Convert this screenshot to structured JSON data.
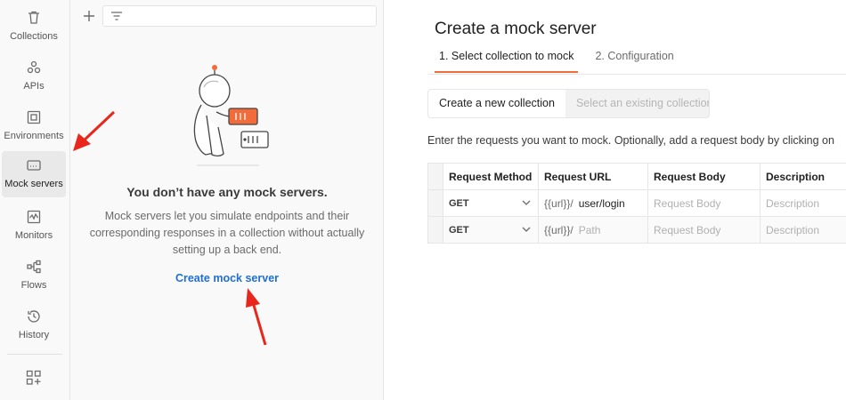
{
  "rail": {
    "items": [
      {
        "label": "Collections",
        "icon": "trash-can-icon"
      },
      {
        "label": "APIs",
        "icon": "apis-icon"
      },
      {
        "label": "Environments",
        "icon": "environments-icon"
      },
      {
        "label": "Mock servers",
        "icon": "server-icon",
        "active": true
      },
      {
        "label": "Monitors",
        "icon": "monitor-icon"
      },
      {
        "label": "Flows",
        "icon": "flows-icon"
      },
      {
        "label": "History",
        "icon": "history-icon"
      }
    ],
    "bottom_icon": "grid-plus-icon"
  },
  "panel": {
    "empty_title": "You don’t have any mock servers.",
    "empty_description": "Mock servers let you simulate endpoints and their corresponding responses in a collection without actually setting up a back end.",
    "create_link": "Create mock server"
  },
  "main": {
    "title": "Create a mock server",
    "steps": [
      "1.  Select collection to mock",
      "2.  Configuration"
    ],
    "segment": {
      "option_new": "Create a new collection",
      "option_existing": "Select an existing collection"
    },
    "instructions": "Enter the requests you want to mock. Optionally, add a request body by clicking on",
    "table": {
      "headers": [
        "Request Method",
        "Request URL",
        "Request Body",
        "Description"
      ],
      "rows": [
        {
          "method": "GET",
          "url_prefix": "{{url}}/",
          "path": "user/login",
          "body_placeholder": "Request Body",
          "description_placeholder": "Description"
        },
        {
          "method": "GET",
          "url_prefix": "{{url}}/",
          "path_placeholder": "Path",
          "body_placeholder": "Request Body",
          "description_placeholder": "Description"
        }
      ]
    }
  },
  "colors": {
    "accent": "#f26b3a",
    "link": "#1f6ed4",
    "annotation_arrow": "#e8261c"
  }
}
